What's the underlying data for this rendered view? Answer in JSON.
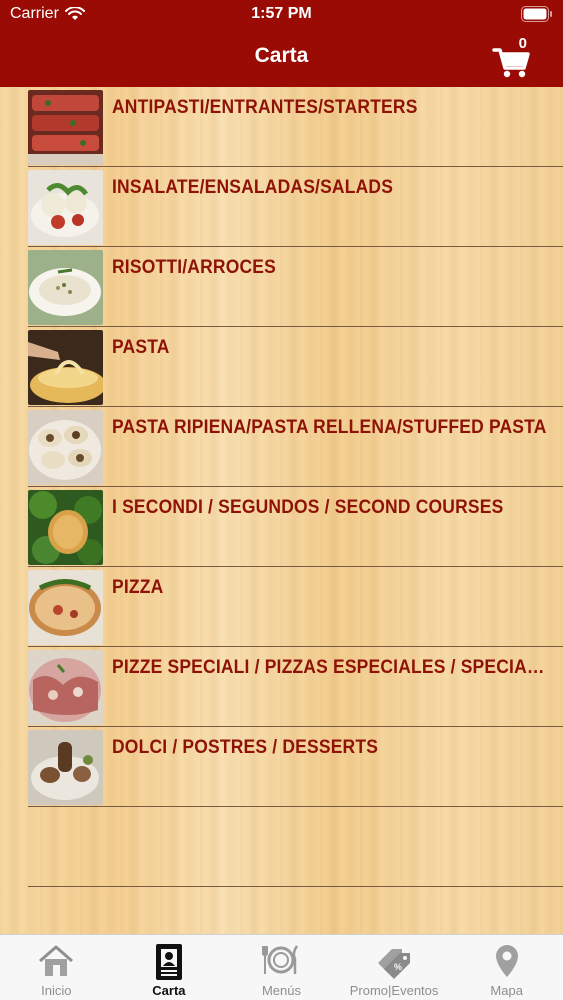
{
  "status": {
    "carrier": "Carrier",
    "time": "1:57 PM"
  },
  "nav": {
    "title": "Carta",
    "cart_count": "0"
  },
  "categories": [
    {
      "label": "ANTIPASTI/ENTRANTES/STARTERS"
    },
    {
      "label": "INSALATE/ENSALADAS/SALADS"
    },
    {
      "label": "RISOTTI/ARROCES"
    },
    {
      "label": "PASTA"
    },
    {
      "label": "PASTA RIPIENA/PASTA RELLENA/STUFFED PASTA"
    },
    {
      "label": "I SECONDI / SEGUNDOS / SECOND COURSES"
    },
    {
      "label": "PIZZA"
    },
    {
      "label": "PIZZE SPECIALI / PIZZAS ESPECIALES / SPECIAL PIZZAS"
    },
    {
      "label": "DOLCI / POSTRES / DESSERTS"
    }
  ],
  "tabs": [
    {
      "label": "Inicio",
      "icon": "home-icon"
    },
    {
      "label": "Carta",
      "icon": "menu-card-icon",
      "active": true
    },
    {
      "label": "Menús",
      "icon": "plate-cutlery-icon"
    },
    {
      "label": "Promo|Eventos",
      "icon": "tags-icon"
    },
    {
      "label": "Mapa",
      "icon": "map-pin-icon"
    }
  ],
  "colors": {
    "bar": "#9a0b05",
    "label": "#8e1208",
    "tab_inactive": "#8e8e8e"
  }
}
